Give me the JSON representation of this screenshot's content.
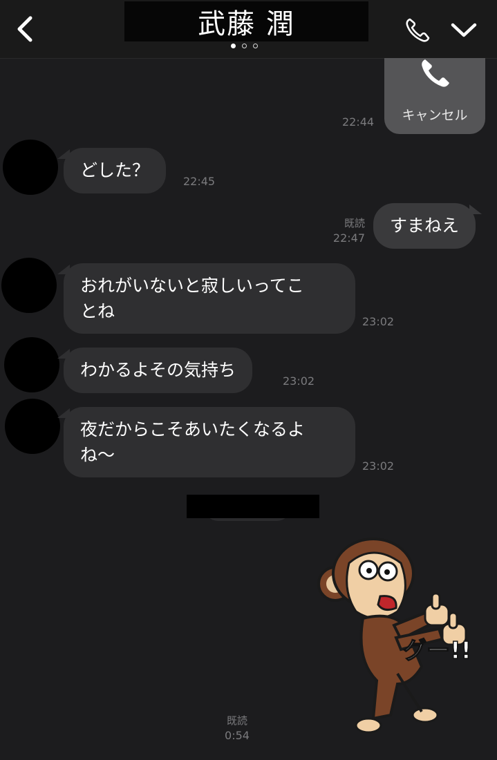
{
  "header": {
    "title": "武藤 潤"
  },
  "messages": [
    {
      "time": "22:44"
    },
    {
      "text": "どした？",
      "time": "22:45"
    },
    {
      "read": "既読",
      "time": "22:47",
      "text": "すまねえ"
    },
    {
      "text": "おれがいないと寂しいってこ\nとね",
      "time": "23:02"
    },
    {
      "text": "わかるよその気持ち",
      "time": "23:02"
    },
    {
      "text": "夜だからこそあいたくなるよ\nね〜",
      "time": "23:02"
    }
  ],
  "call_card": {
    "label": "キャンセル"
  },
  "sticker": {
    "caption": "グー!!",
    "read": "既読",
    "time": "0:54"
  },
  "icons": [
    "back-chevron-icon",
    "phone-icon",
    "chevron-down-icon"
  ],
  "colors": {
    "background": "#1c1c1e",
    "bubble": "#2f2f31",
    "call_card": "#555557"
  }
}
